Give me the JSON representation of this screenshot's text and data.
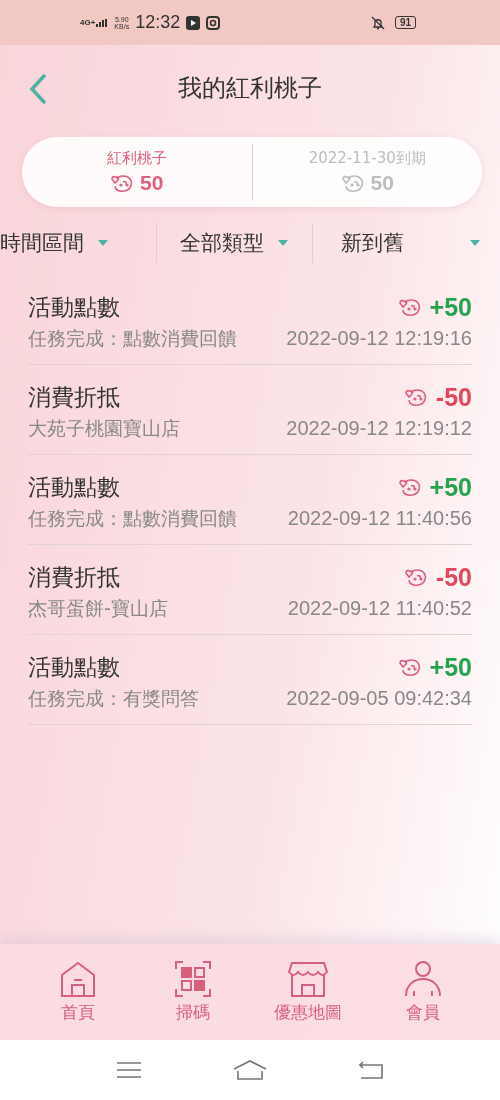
{
  "status_bar": {
    "network": "4G+",
    "speed": "5.90",
    "speed_unit": "KB/s",
    "time": "12:32",
    "battery": "91"
  },
  "header": {
    "title": "我的紅利桃子"
  },
  "summary": [
    {
      "kind": "balance",
      "label": "紅利桃子",
      "value": "50"
    },
    {
      "kind": "expiring",
      "label": "2022-11-30到期",
      "value": "50"
    }
  ],
  "filters": [
    {
      "label": "時間區間"
    },
    {
      "label": "全部類型"
    },
    {
      "label": "新到舊"
    }
  ],
  "records": [
    {
      "title": "活動點數",
      "subtitle": "任務完成：點數消費回饋",
      "kind": "earn",
      "amount": "+50",
      "time": "2022-09-12 12:19:16"
    },
    {
      "title": "消費折抵",
      "subtitle": "大苑子桃園寶山店",
      "kind": "spend",
      "amount": "-50",
      "time": "2022-09-12 12:19:12"
    },
    {
      "title": "活動點數",
      "subtitle": "任務完成：點數消費回饋",
      "kind": "earn",
      "amount": "+50",
      "time": "2022-09-12 11:40:56"
    },
    {
      "title": "消費折抵",
      "subtitle": "杰哥蛋餅-寶山店",
      "kind": "spend",
      "amount": "-50",
      "time": "2022-09-12 11:40:52"
    },
    {
      "title": "活動點數",
      "subtitle": "任務完成：有獎問答",
      "kind": "earn",
      "amount": "+50",
      "time": "2022-09-05 09:42:34"
    }
  ],
  "bottom_nav": [
    {
      "kind": "home",
      "label": "首頁"
    },
    {
      "kind": "scan",
      "label": "掃碼"
    },
    {
      "kind": "store",
      "label": "優惠地圖"
    },
    {
      "kind": "member",
      "label": "會員"
    }
  ]
}
